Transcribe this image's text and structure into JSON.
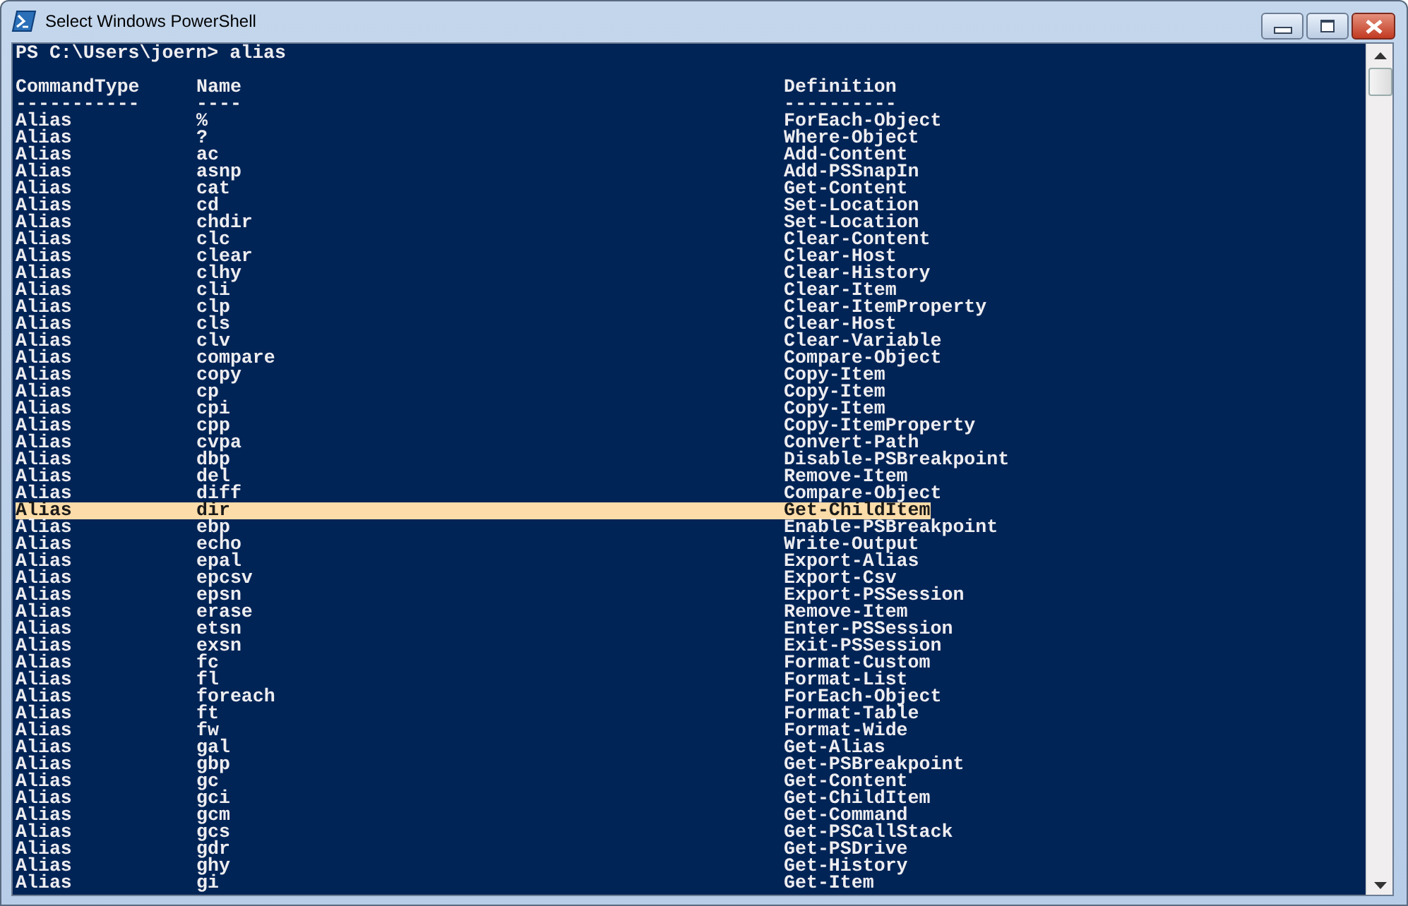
{
  "window": {
    "title": "Select Windows PowerShell"
  },
  "console": {
    "prompt": "PS C:\\Users\\joern> alias",
    "columns": [
      {
        "heading": "CommandType",
        "underline": "-----------"
      },
      {
        "heading": "Name",
        "underline": "----"
      },
      {
        "heading": "Definition",
        "underline": "----------"
      }
    ],
    "rows": [
      {
        "type": "Alias",
        "name": "%",
        "definition": "ForEach-Object",
        "selected": false
      },
      {
        "type": "Alias",
        "name": "?",
        "definition": "Where-Object",
        "selected": false
      },
      {
        "type": "Alias",
        "name": "ac",
        "definition": "Add-Content",
        "selected": false
      },
      {
        "type": "Alias",
        "name": "asnp",
        "definition": "Add-PSSnapIn",
        "selected": false
      },
      {
        "type": "Alias",
        "name": "cat",
        "definition": "Get-Content",
        "selected": false
      },
      {
        "type": "Alias",
        "name": "cd",
        "definition": "Set-Location",
        "selected": false
      },
      {
        "type": "Alias",
        "name": "chdir",
        "definition": "Set-Location",
        "selected": false
      },
      {
        "type": "Alias",
        "name": "clc",
        "definition": "Clear-Content",
        "selected": false
      },
      {
        "type": "Alias",
        "name": "clear",
        "definition": "Clear-Host",
        "selected": false
      },
      {
        "type": "Alias",
        "name": "clhy",
        "definition": "Clear-History",
        "selected": false
      },
      {
        "type": "Alias",
        "name": "cli",
        "definition": "Clear-Item",
        "selected": false
      },
      {
        "type": "Alias",
        "name": "clp",
        "definition": "Clear-ItemProperty",
        "selected": false
      },
      {
        "type": "Alias",
        "name": "cls",
        "definition": "Clear-Host",
        "selected": false
      },
      {
        "type": "Alias",
        "name": "clv",
        "definition": "Clear-Variable",
        "selected": false
      },
      {
        "type": "Alias",
        "name": "compare",
        "definition": "Compare-Object",
        "selected": false
      },
      {
        "type": "Alias",
        "name": "copy",
        "definition": "Copy-Item",
        "selected": false
      },
      {
        "type": "Alias",
        "name": "cp",
        "definition": "Copy-Item",
        "selected": false
      },
      {
        "type": "Alias",
        "name": "cpi",
        "definition": "Copy-Item",
        "selected": false
      },
      {
        "type": "Alias",
        "name": "cpp",
        "definition": "Copy-ItemProperty",
        "selected": false
      },
      {
        "type": "Alias",
        "name": "cvpa",
        "definition": "Convert-Path",
        "selected": false
      },
      {
        "type": "Alias",
        "name": "dbp",
        "definition": "Disable-PSBreakpoint",
        "selected": false
      },
      {
        "type": "Alias",
        "name": "del",
        "definition": "Remove-Item",
        "selected": false
      },
      {
        "type": "Alias",
        "name": "diff",
        "definition": "Compare-Object",
        "selected": false
      },
      {
        "type": "Alias",
        "name": "dir",
        "definition": "Get-ChildItem",
        "selected": true
      },
      {
        "type": "Alias",
        "name": "ebp",
        "definition": "Enable-PSBreakpoint",
        "selected": false
      },
      {
        "type": "Alias",
        "name": "echo",
        "definition": "Write-Output",
        "selected": false
      },
      {
        "type": "Alias",
        "name": "epal",
        "definition": "Export-Alias",
        "selected": false
      },
      {
        "type": "Alias",
        "name": "epcsv",
        "definition": "Export-Csv",
        "selected": false
      },
      {
        "type": "Alias",
        "name": "epsn",
        "definition": "Export-PSSession",
        "selected": false
      },
      {
        "type": "Alias",
        "name": "erase",
        "definition": "Remove-Item",
        "selected": false
      },
      {
        "type": "Alias",
        "name": "etsn",
        "definition": "Enter-PSSession",
        "selected": false
      },
      {
        "type": "Alias",
        "name": "exsn",
        "definition": "Exit-PSSession",
        "selected": false
      },
      {
        "type": "Alias",
        "name": "fc",
        "definition": "Format-Custom",
        "selected": false
      },
      {
        "type": "Alias",
        "name": "fl",
        "definition": "Format-List",
        "selected": false
      },
      {
        "type": "Alias",
        "name": "foreach",
        "definition": "ForEach-Object",
        "selected": false
      },
      {
        "type": "Alias",
        "name": "ft",
        "definition": "Format-Table",
        "selected": false
      },
      {
        "type": "Alias",
        "name": "fw",
        "definition": "Format-Wide",
        "selected": false
      },
      {
        "type": "Alias",
        "name": "gal",
        "definition": "Get-Alias",
        "selected": false
      },
      {
        "type": "Alias",
        "name": "gbp",
        "definition": "Get-PSBreakpoint",
        "selected": false
      },
      {
        "type": "Alias",
        "name": "gc",
        "definition": "Get-Content",
        "selected": false
      },
      {
        "type": "Alias",
        "name": "gci",
        "definition": "Get-ChildItem",
        "selected": false
      },
      {
        "type": "Alias",
        "name": "gcm",
        "definition": "Get-Command",
        "selected": false
      },
      {
        "type": "Alias",
        "name": "gcs",
        "definition": "Get-PSCallStack",
        "selected": false
      },
      {
        "type": "Alias",
        "name": "gdr",
        "definition": "Get-PSDrive",
        "selected": false
      },
      {
        "type": "Alias",
        "name": "ghy",
        "definition": "Get-History",
        "selected": false
      },
      {
        "type": "Alias",
        "name": "gi",
        "definition": "Get-Item",
        "selected": false
      }
    ]
  }
}
